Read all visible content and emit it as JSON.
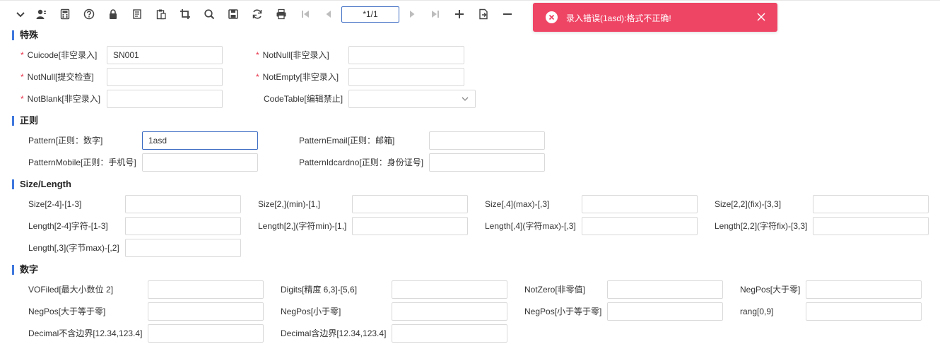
{
  "toolbar": {
    "icons": [
      "chevron-down-icon",
      "user-icon",
      "calculator-icon",
      "help-icon",
      "lock-icon",
      "copy-icon",
      "paste-icon",
      "crop-icon",
      "search-icon",
      "save-icon",
      "refresh-icon",
      "print-icon",
      "first-page-icon",
      "prev-page-icon",
      "next-page-icon",
      "last-page-icon",
      "add-icon",
      "export-icon",
      "remove-icon"
    ],
    "page_value": "*1/1"
  },
  "toast": {
    "message": "录入错误(1asd):格式不正确!",
    "color": "#ef4565"
  },
  "sections": {
    "special": "特殊",
    "regex": "正则",
    "size": "Size/Length",
    "number": "数字"
  },
  "special": {
    "cuicode_label": "Cuicode[非空录入]",
    "cuicode_value": "SN001",
    "notnull1_label": "NotNull[非空录入]",
    "notnull2_label": "NotNull[提交检查]",
    "notempty_label": "NotEmpty[非空录入]",
    "notblank_label": "NotBlank[非空录入]",
    "codetable_label": "CodeTable[编辑禁止]"
  },
  "regex": {
    "pattern_label": "Pattern[正则：数字]",
    "pattern_value": "1asd",
    "email_label": "PatternEmail[正则：邮箱]",
    "mobile_label": "PatternMobile[正则：手机号]",
    "idcard_label": "PatternIdcardno[正则：身份证号]"
  },
  "size": {
    "size1": "Size[2-4]-[1-3]",
    "size2": "Size[2,](min)-[1,]",
    "size3": "Size[,4](max)-[,3]",
    "size4": "Size[2,2](fix)-[3,3]",
    "len1": "Length[2-4]字符-[1-3]",
    "len2": "Length[2,](字符min)-[1,]",
    "len3": "Length[,4](字符max)-[,3]",
    "len4": "Length[2,2](字符fix)-[3,3]",
    "len5": "Length[,3](字节max)-[,2]"
  },
  "number": {
    "n1": "VOFiled[最大小数位 2]",
    "n2": "Digits[精度 6,3]-[5,6]",
    "n3": "NotZero[非零值]",
    "n4": "NegPos[大于零]",
    "n5": "NegPos[大于等于零]",
    "n6": "NegPos[小于零]",
    "n7": "NegPos[小于等于零]",
    "n8": "rang[0,9]",
    "n9": "Decimal不含边界[12.34,123.4]",
    "n10": "Decimal含边界[12.34,123.4]"
  },
  "required_mark": "*"
}
